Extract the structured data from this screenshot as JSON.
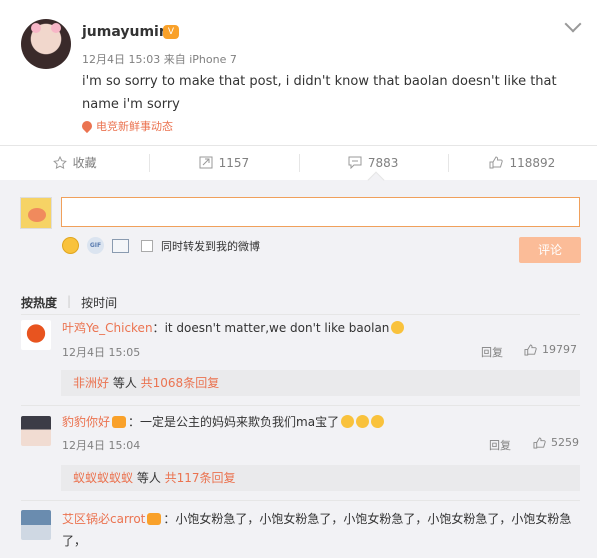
{
  "post": {
    "username": "jumayumin",
    "date": "12月4日 15:03",
    "source_prefix": "来自",
    "source": "iPhone 7",
    "text": "i'm so sorry to make that post, i didn't know that baolan doesn't like that name i'm sorry",
    "topic": "电竞新鲜事动态"
  },
  "actions": {
    "favorite": "收藏",
    "repost": "1157",
    "comment": "7883",
    "like": "118892"
  },
  "composer": {
    "placeholder": "",
    "also_repost": "同时转发到我的微博",
    "submit": "评论"
  },
  "sort": {
    "hot": "按热度",
    "time": "按时间"
  },
  "comments": [
    {
      "user": "叶鸡Ye_Chicken",
      "sep": "：",
      "text": "it doesn't matter,we don't like baolan",
      "time": "12月4日 15:05",
      "reply": "回复",
      "likes": "19797",
      "replies_users": "非洲好",
      "replies_mid": " 等人 ",
      "replies_count": "共1068条回复"
    },
    {
      "user": "豹豹你好",
      "sep": "：",
      "text": "一定是公主的妈妈来欺负我们ma宝了",
      "time": "12月4日 15:04",
      "reply": "回复",
      "likes": "5259",
      "replies_users": "蚁蚁蚁蚁蚁",
      "replies_mid": " 等人 ",
      "replies_count": "共117条回复"
    },
    {
      "user": "艾区锅必carrot",
      "sep": "：",
      "text": "小饱女粉急了，小饱女粉急了，小饱女粉急了，小饱女粉急了，小饱女粉急了，"
    }
  ],
  "colors": {
    "accent": "#eb7350",
    "submit_bg": "#fbbc98",
    "panel_bg": "#f2f2f5"
  }
}
